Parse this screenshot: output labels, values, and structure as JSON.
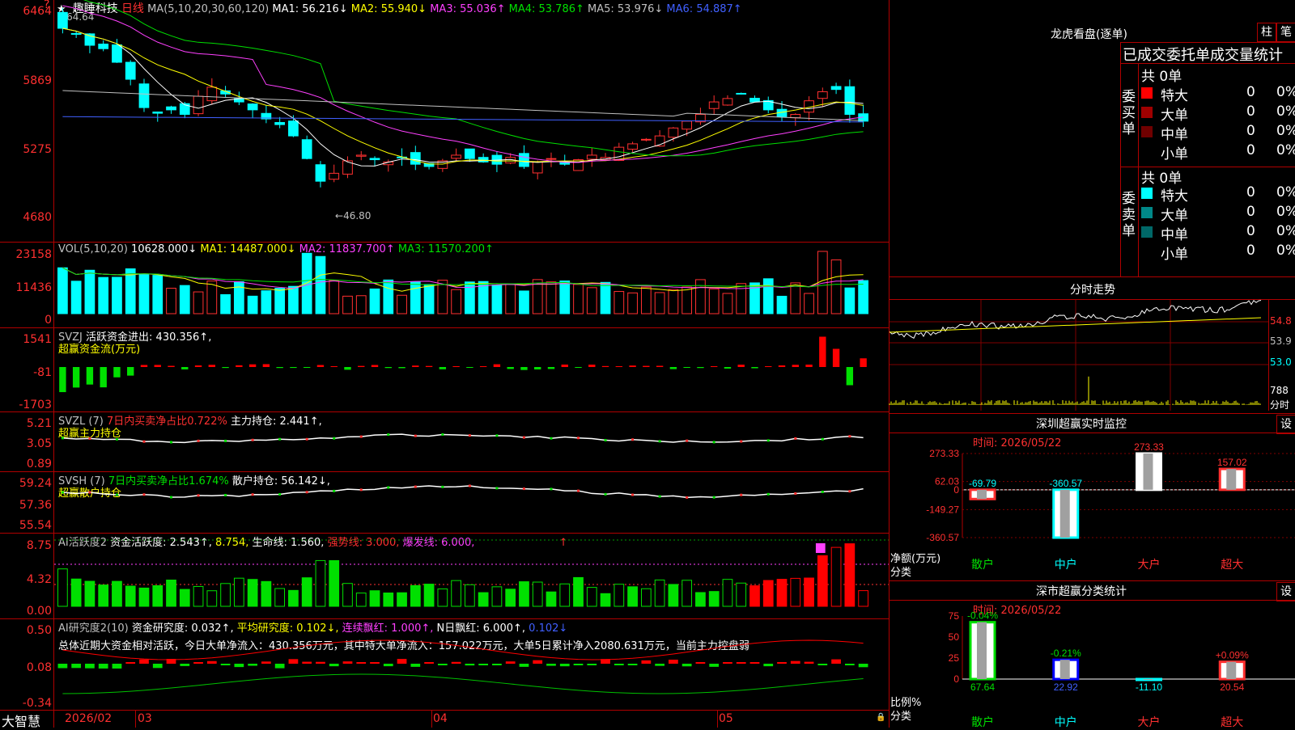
{
  "main_chart": {
    "star_icon": "star-icon",
    "stock_name": "趣睡科技",
    "period": "日线",
    "ma_title": "MA(5,10,20,30,60,120)",
    "ma_values": [
      {
        "label": "MA1: 56.216↓",
        "color": "#ffffff"
      },
      {
        "label": "MA2: 55.940↓",
        "color": "#ffff00"
      },
      {
        "label": "MA3: 55.036↑",
        "color": "#ff40ff"
      },
      {
        "label": "MA4: 53.786↑",
        "color": "#00e000"
      },
      {
        "label": "MA5: 53.976↓",
        "color": "#c0c0c0"
      },
      {
        "label": "MA6: 54.887↑",
        "color": "#4060ff"
      }
    ],
    "y_ticks": [
      "6464",
      "5869",
      "5275",
      "4680"
    ],
    "high_label": "64.64",
    "low_label": "46.80"
  },
  "vol_panel": {
    "title": "VOL(5,10,20)",
    "value": "10628.000↓",
    "ma1": "MA1: 14487.000↓",
    "ma2": "MA2: 11837.700↑",
    "ma3": "MA3: 11570.200↑",
    "y_ticks": [
      "23158",
      "11436",
      "0"
    ]
  },
  "svzj_panel": {
    "title": "SVZJ",
    "value": "活跃资金进出: 430.356↑,",
    "subtitle": "超赢资金流(万元)",
    "y_ticks": [
      "1541",
      "-81",
      "-1703"
    ]
  },
  "svzl_panel": {
    "title": "SVZL (7)",
    "ratio": "7日内买卖净占比0.722%",
    "value": "主力持仓: 2.441↑,",
    "subtitle": "超赢主力持仓",
    "y_ticks": [
      "5.21",
      "3.05",
      "0.89"
    ]
  },
  "svsh_panel": {
    "title": "SVSH (7)",
    "ratio": "7日内买卖净占比1.674%",
    "value": "散户持仓: 56.142↓,",
    "subtitle": "超赢散户持仓",
    "y_ticks": [
      "59.24",
      "57.36",
      "55.54"
    ]
  },
  "ai2_panel": {
    "title": "AI活跃度2",
    "v1": "资金活跃度: 2.543↑,",
    "v2": "8.754,",
    "v3": "生命线: 1.560,",
    "v4": "强势线: 3.000,",
    "v5": "爆发线: 6.000,",
    "arrow": "↑",
    "y_ticks": [
      "8.75",
      "4.32",
      "0.00"
    ]
  },
  "ai_research_panel": {
    "title": "AI研究度2(10)",
    "v1": "资金研究度: 0.032↑,",
    "v2": "平均研究度: 0.102↓,",
    "v3": "连续飘红: 1.000↑,",
    "v4": "N日飘红: 6.000↑,",
    "v5": "0.102↓",
    "comment": "总体近期大资金相对活跃，今日大单净流入：430.356万元，其中特大单净流入：157.022万元，大单5日累计净入2080.631万元，当前主力控盘弱",
    "y_ticks": [
      "0.50",
      "0.08",
      "-0.34"
    ]
  },
  "bottom_axis": {
    "brand": "大智慧",
    "dates": [
      "2026/02",
      "03",
      "04",
      "05"
    ]
  },
  "right_panel": {
    "lhb_title": "龙虎看盘(逐单)",
    "btn_bar": "柱",
    "btn_tick": "笔",
    "stats_title": "已成交委托单成交量统计",
    "buy": {
      "side_label": "委买单",
      "total": "共 0单",
      "rows": [
        {
          "name": "特大",
          "qty": "0",
          "pct": "0%",
          "color": "#ff0000"
        },
        {
          "name": "大单",
          "qty": "0",
          "pct": "0%",
          "color": "#a00000"
        },
        {
          "name": "中单",
          "qty": "0",
          "pct": "0%",
          "color": "#700000"
        },
        {
          "name": "小单",
          "qty": "0",
          "pct": "0%",
          "color": ""
        }
      ]
    },
    "sell": {
      "side_label": "委卖单",
      "total": "共 0单",
      "rows": [
        {
          "name": "特大",
          "qty": "0",
          "pct": "0%",
          "color": "#00ffff"
        },
        {
          "name": "大单",
          "qty": "0",
          "pct": "0%",
          "color": "#008888"
        },
        {
          "name": "中单",
          "qty": "0",
          "pct": "0%",
          "color": "#006868"
        },
        {
          "name": "小单",
          "qty": "0",
          "pct": "0%",
          "color": ""
        }
      ]
    },
    "intraday": {
      "title": "分时走势",
      "prices": [
        "54.8",
        "53.9",
        "53.0"
      ],
      "vol": "788",
      "vol_label": "分时"
    },
    "sz_monitor": {
      "title": "深圳超赢实时监控",
      "btn": "设",
      "time": "时间: 2026/05/22",
      "y_ticks": [
        "273.33",
        "62.03",
        "0",
        "-149.27",
        "-360.57"
      ],
      "bars": [
        {
          "cat": "散户",
          "value": -69.79,
          "label": "-69.79"
        },
        {
          "cat": "中户",
          "value": -360.57,
          "label": "-360.57"
        },
        {
          "cat": "大户",
          "value": 273.33,
          "label": "273.33"
        },
        {
          "cat": "超大",
          "value": 157.02,
          "label": "157.02"
        }
      ],
      "ylabel": "净额(万元)",
      "xlabel": "分类"
    },
    "sz_class": {
      "title": "深市超赢分类统计",
      "btn": "设",
      "time": "时间: 2026/05/22",
      "y_ticks": [
        "75",
        "50",
        "25",
        "0"
      ],
      "bars": [
        {
          "cat": "散户",
          "value": 67.64,
          "label": "67.64",
          "chg": "-0.04%"
        },
        {
          "cat": "中户",
          "value": 22.92,
          "label": "22.92",
          "chg": "-0.21%"
        },
        {
          "cat": "大户",
          "value": -11.1,
          "label": "-11.10",
          "chg": ""
        },
        {
          "cat": "超大",
          "value": 20.54,
          "label": "20.54",
          "chg": "+0.09%"
        }
      ],
      "ylabel": "比例%",
      "xlabel": "分类"
    }
  },
  "chart_data": [
    {
      "type": "line",
      "title": "趣睡科技 日线",
      "series": [
        {
          "name": "MA1",
          "values": [
            63.2,
            62.5,
            61.4,
            60.3,
            59.0,
            57.6,
            56.4,
            55.8,
            55.4,
            55.6,
            56.1,
            56.3,
            56.0,
            55.4,
            54.3,
            52.8,
            51.4,
            50.3,
            49.8,
            50.0,
            50.5,
            50.8,
            51.0,
            51.1,
            51.3,
            51.4,
            51.6,
            51.7,
            51.8,
            51.9,
            52.0,
            52.2,
            52.5,
            53.0,
            53.8,
            54.6,
            55.3,
            55.8,
            56.0,
            56.2,
            56.2,
            56.2
          ]
        },
        {
          "name": "MA6",
          "values": [
            55.2,
            55.2,
            55.2,
            55.2,
            55.2,
            55.2,
            55.2,
            55.1,
            55.1,
            55.1,
            55.0,
            55.0,
            55.0,
            54.9,
            54.9,
            54.9,
            54.8,
            54.8,
            54.8,
            54.7,
            54.7,
            54.7,
            54.7,
            54.7,
            54.7,
            54.7,
            54.7,
            54.7,
            54.7,
            54.8,
            54.8,
            54.8,
            54.8,
            54.8,
            54.8,
            54.8,
            54.9,
            54.9,
            54.9,
            54.9,
            54.9,
            54.9
          ]
        }
      ],
      "high": 64.64,
      "low": 46.8
    },
    {
      "type": "bar",
      "title": "深圳超赢实时监控",
      "xlabel": "分类",
      "ylabel": "净额(万元)",
      "categories": [
        "散户",
        "中户",
        "大户",
        "超大"
      ],
      "values": [
        -69.79,
        -360.57,
        273.33,
        157.02
      ],
      "ylim": [
        -360.57,
        273.33
      ]
    },
    {
      "type": "bar",
      "title": "深市超赢分类统计",
      "xlabel": "分类",
      "ylabel": "比例%",
      "categories": [
        "散户",
        "中户",
        "大户",
        "超大"
      ],
      "values": [
        67.64,
        22.92,
        -11.1,
        20.54
      ],
      "ylim": [
        0,
        75
      ]
    }
  ],
  "colors": {
    "up": "#ff3030",
    "down": "#00ffff",
    "grid": "#b00000",
    "bg": "#000000"
  }
}
